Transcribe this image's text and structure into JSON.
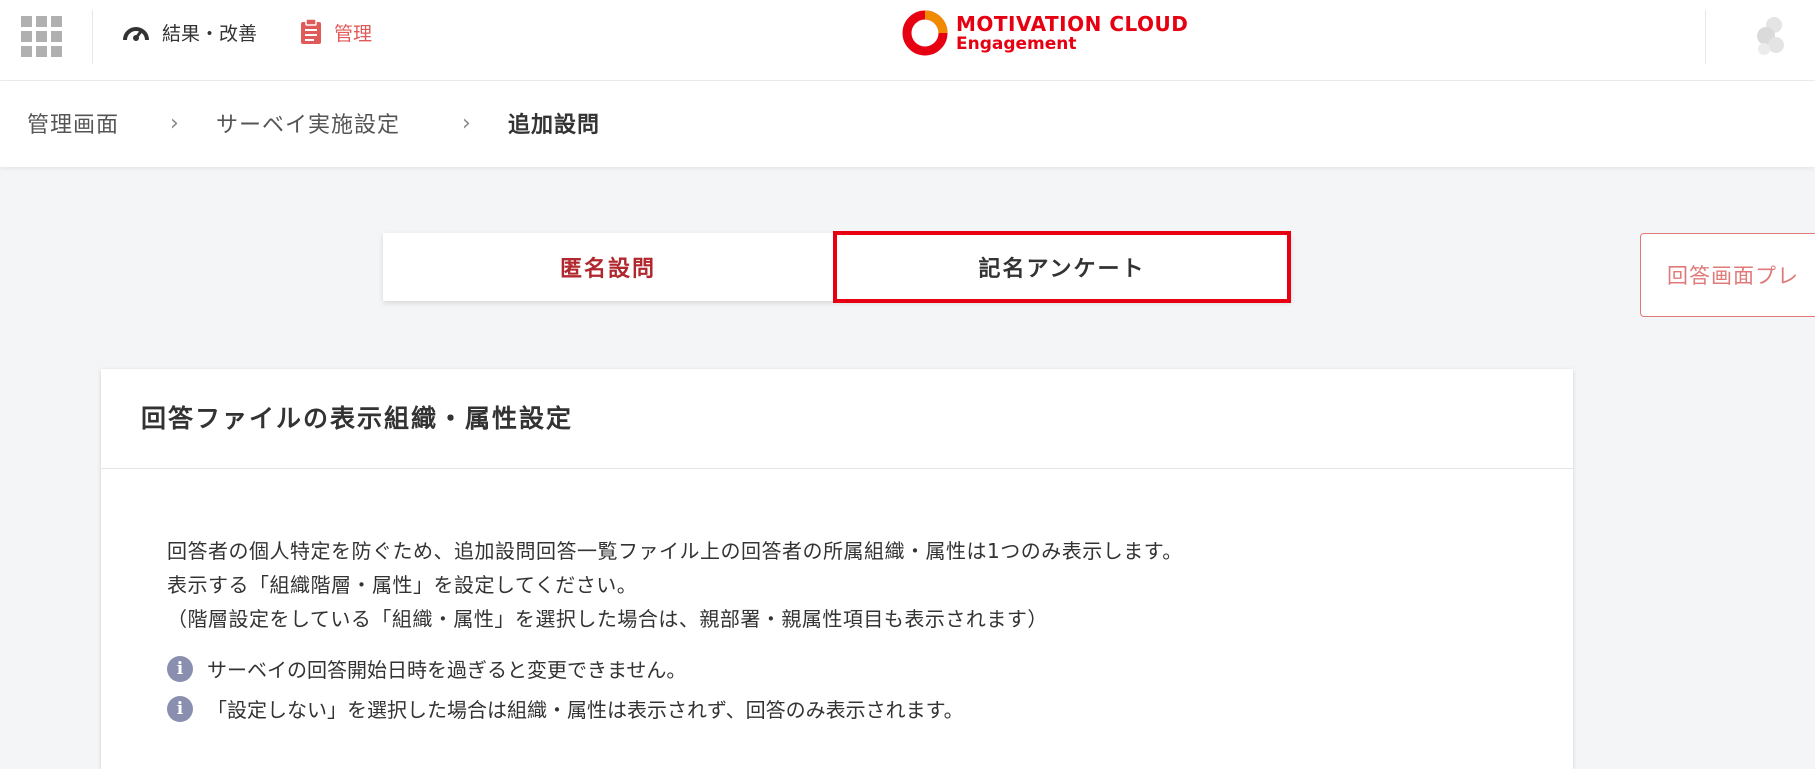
{
  "topbar": {
    "apps_icon": "grid-icon",
    "nav": [
      {
        "label": "結果・改善",
        "icon": "speedometer-icon",
        "color": "#333333"
      },
      {
        "label": "管理",
        "icon": "clipboard-icon",
        "color": "#e05a5a"
      }
    ],
    "logo": {
      "line1": "MOTIVATION CLOUD",
      "line2": "Engagement",
      "color": "#e60012"
    },
    "user_icon": "user-avatar-icon"
  },
  "breadcrumb": {
    "items": [
      "管理画面",
      "サーベイ実施設定"
    ],
    "current": "追加設問",
    "separator": "›"
  },
  "tabs": [
    {
      "label": "匿名設問",
      "active": false
    },
    {
      "label": "記名アンケート",
      "active": true
    }
  ],
  "preview_button": {
    "label": "回答画面プレ"
  },
  "card": {
    "title": "回答ファイルの表示組織・属性設定",
    "description": [
      "回答者の個人特定を防ぐため、追加設問回答一覧ファイル上の回答者の所属組織・属性は1つのみ表示します。",
      "表示する「組織階層・属性」を設定してください。",
      "（階層設定をしている「組織・属性」を選択した場合は、親部署・親属性項目も表示されます）"
    ],
    "notes": [
      "サーベイの回答開始日時を過ぎると変更できません。",
      "「設定しない」を選択した場合は組織・属性は表示されず、回答のみ表示されます。"
    ]
  },
  "colors": {
    "accent": "#e60012",
    "tab_inactive": "#b0282e",
    "info_icon": "#8a8fb0"
  }
}
